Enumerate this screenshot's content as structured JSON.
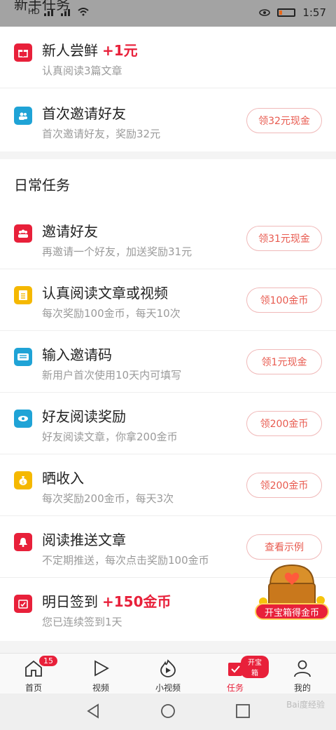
{
  "status": {
    "title_peek": "新手任务",
    "time": "1:57",
    "net": "HD"
  },
  "newbie": [
    {
      "title": "新人尝鲜",
      "accent": "+1元",
      "sub": "认真阅读3篇文章",
      "icon": "gift-icon",
      "color": "#e8203a"
    },
    {
      "title": "首次邀请好友",
      "sub": "首次邀请好友，奖励32元",
      "btn": "领32元现金",
      "icon": "people-icon",
      "color": "#1fa3d6"
    }
  ],
  "daily_title": "日常任务",
  "daily": [
    {
      "title": "邀请好友",
      "sub": "再邀请一个好友，加送奖励31元",
      "btn": "领31元现金",
      "icon": "group-icon",
      "color": "#e8203a"
    },
    {
      "title": "认真阅读文章或视频",
      "sub": "每次奖励100金币，每天10次",
      "btn": "领100金币",
      "icon": "document-icon",
      "color": "#f5b800"
    },
    {
      "title": "输入邀请码",
      "sub": "新用户首次使用10天内可填写",
      "btn": "领1元现金",
      "icon": "ticket-icon",
      "color": "#1fa3d6"
    },
    {
      "title": "好友阅读奖励",
      "sub": "好友阅读文章，你拿200金币",
      "btn": "领200金币",
      "icon": "eye-icon",
      "color": "#1fa3d6"
    },
    {
      "title": "晒收入",
      "sub": "每次奖励200金币，每天3次",
      "btn": "领200金币",
      "icon": "moneybag-icon",
      "color": "#f5b800"
    },
    {
      "title": "阅读推送文章",
      "sub": "不定期推送，每次点击奖励100金币",
      "btn": "查看示例",
      "icon": "bell-icon",
      "color": "#e8203a"
    },
    {
      "title": "明日签到",
      "accent": "+150金币",
      "sub": "您已连续签到1天",
      "icon": "calendar-icon",
      "color": "#e8203a"
    }
  ],
  "treasure": {
    "label": "开宝箱得金币"
  },
  "tabs": [
    {
      "label": "首页",
      "badge": "15",
      "icon": "home-icon"
    },
    {
      "label": "视频",
      "icon": "play-icon"
    },
    {
      "label": "小视频",
      "icon": "flame-play-icon"
    },
    {
      "label": "任务",
      "badge": "开宝箱",
      "icon": "task-icon",
      "active": true
    },
    {
      "label": "我的",
      "icon": "user-icon"
    }
  ],
  "watermark": "Bai度经验"
}
